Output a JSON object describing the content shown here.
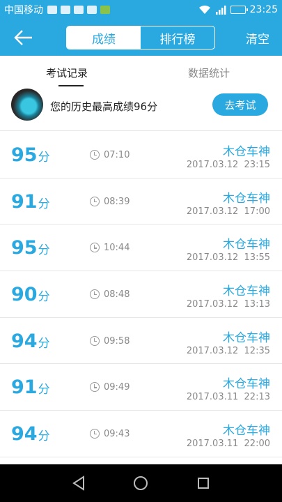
{
  "status_bar": {
    "carrier": "中国移动",
    "time": "23:25",
    "icons": [
      "notification-icon",
      "sim-icon",
      "mail-icon",
      "cloud-icon",
      "app-icon",
      "wifi-icon",
      "signal-icon",
      "battery-icon"
    ]
  },
  "header": {
    "back_icon": "back-arrow-icon",
    "tabs": [
      {
        "label": "成绩",
        "active": true
      },
      {
        "label": "排行榜",
        "active": false
      }
    ],
    "clear_label": "清空"
  },
  "subtabs": {
    "record_label": "考试记录",
    "stats_label": "数据统计"
  },
  "best": {
    "text": "您的历史最高成绩96分",
    "button_label": "去考试"
  },
  "records": [
    {
      "score": "95",
      "unit": "分",
      "duration": "07:10",
      "player": "木仓车神",
      "datetime": "2017.03.12  23:15"
    },
    {
      "score": "91",
      "unit": "分",
      "duration": "08:39",
      "player": "木仓车神",
      "datetime": "2017.03.12  17:00"
    },
    {
      "score": "95",
      "unit": "分",
      "duration": "10:44",
      "player": "木仓车神",
      "datetime": "2017.03.12  13:55"
    },
    {
      "score": "90",
      "unit": "分",
      "duration": "08:48",
      "player": "木仓车神",
      "datetime": "2017.03.12  13:13"
    },
    {
      "score": "94",
      "unit": "分",
      "duration": "09:58",
      "player": "木仓车神",
      "datetime": "2017.03.12  12:35"
    },
    {
      "score": "91",
      "unit": "分",
      "duration": "09:49",
      "player": "木仓车神",
      "datetime": "2017.03.11  22:13"
    },
    {
      "score": "94",
      "unit": "分",
      "duration": "09:43",
      "player": "木仓车神",
      "datetime": "2017.03.11  22:00"
    }
  ],
  "colors": {
    "accent": "#2aa8e0",
    "text": "#222222",
    "muted": "#888888"
  }
}
